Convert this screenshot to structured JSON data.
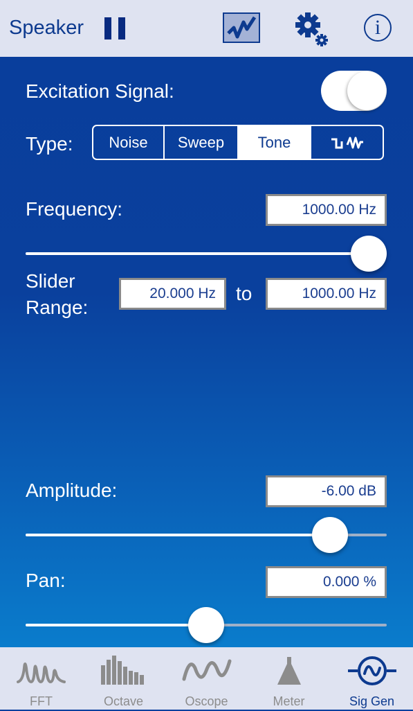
{
  "header": {
    "title": "Speaker",
    "pause_icon": "pause-icon",
    "graph_icon": "graph-icon",
    "settings_icon": "gear-icon",
    "info_icon": "info-icon",
    "info_glyph": "i"
  },
  "excitation": {
    "label": "Excitation Signal:",
    "enabled": true
  },
  "type": {
    "label": "Type:",
    "options": [
      "Noise",
      "Sweep",
      "Tone",
      "square-sine-icon"
    ],
    "selected": "Tone"
  },
  "frequency": {
    "label": "Frequency:",
    "value": "1000.00 Hz",
    "slider_fraction": 1.0
  },
  "slider_range": {
    "label_line1": "Slider",
    "label_line2": "Range:",
    "min": "20.000 Hz",
    "to_label": "to",
    "max": "1000.00 Hz"
  },
  "amplitude": {
    "label": "Amplitude:",
    "value": "-6.00 dB",
    "slider_fraction": 0.88
  },
  "pan": {
    "label": "Pan:",
    "value": "0.000 %",
    "slider_fraction": 0.5
  },
  "tabs": [
    {
      "label": "FFT",
      "icon": "fft-icon"
    },
    {
      "label": "Octave",
      "icon": "octave-icon"
    },
    {
      "label": "Oscope",
      "icon": "oscope-icon"
    },
    {
      "label": "Meter",
      "icon": "meter-icon"
    },
    {
      "label": "Sig Gen",
      "icon": "sig-gen-icon",
      "active": true
    }
  ],
  "colors": {
    "accent": "#0d3a8f",
    "background_top": "#093e9c",
    "background_bottom": "#0a7ccc",
    "bar": "#dfe3f1",
    "inactive_tab": "#8c8c8c"
  }
}
